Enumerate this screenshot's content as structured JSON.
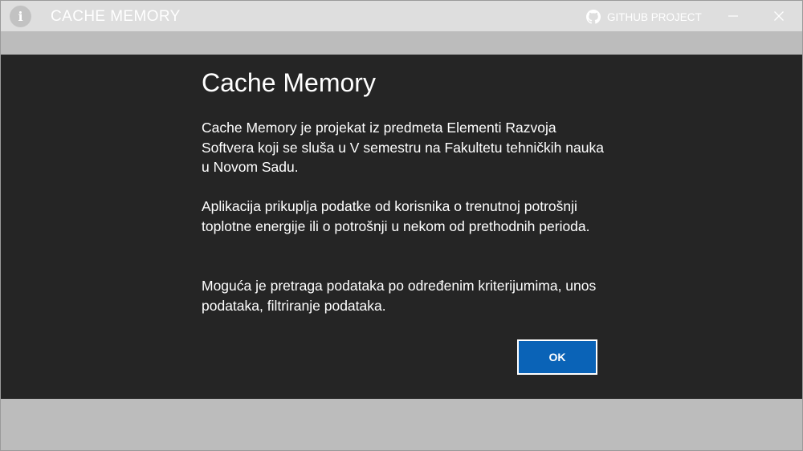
{
  "window": {
    "title": "CACHE MEMORY",
    "app_icon_glyph": "i",
    "github_label": "GITHUB PROJECT",
    "github_icon": "github-icon",
    "minimize_icon": "minimize-icon",
    "close_icon": "close-icon"
  },
  "dialog": {
    "title": "Cache Memory",
    "paragraphs": [
      "Cache Memory je projekat iz predmeta Elementi Razvoja Softvera koji se sluša u V semestru na Fakultetu tehničkih nauka u Novom Sadu.",
      "Aplikacija prikuplja podatke od korisnika o trenutnoj potrošnji toplotne energije ili o potrošnji u nekom od prethodnih perioda.",
      "Moguća je pretraga podataka po određenim kriterijumima, unos podataka, filtriranje podataka."
    ],
    "ok_label": "OK"
  },
  "colors": {
    "title_bar": "#dedede",
    "background": "#bcbcbc",
    "dialog_background": "#252525",
    "accent": "#0a63b7",
    "text": "#ffffff"
  }
}
